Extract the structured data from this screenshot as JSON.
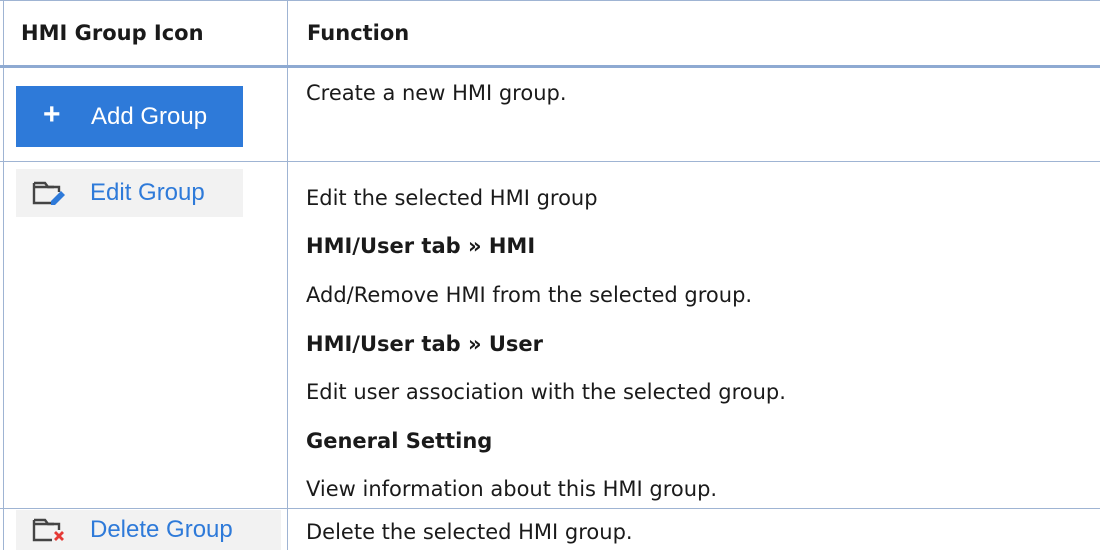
{
  "header": {
    "col1": "HMI Group Icon",
    "col2": "Function"
  },
  "rows": [
    {
      "button_label": "Add Group",
      "button_icon": "plus-icon",
      "lines": [
        {
          "text": "Create a new HMI group.",
          "bold": false
        }
      ]
    },
    {
      "button_label": "Edit Group",
      "button_icon": "folder-edit-icon",
      "lines": [
        {
          "text": "Edit the selected HMI group",
          "bold": false
        },
        {
          "text": "HMI/User tab » HMI",
          "bold": true
        },
        {
          "text": "Add/Remove HMI from the selected group.",
          "bold": false
        },
        {
          "text": "HMI/User tab » User",
          "bold": true
        },
        {
          "text": "Edit user association with the selected group.",
          "bold": false
        },
        {
          "text": "General Setting",
          "bold": true
        },
        {
          "text": "View information about this HMI group.",
          "bold": false
        }
      ]
    },
    {
      "button_label": "Delete Group",
      "button_icon": "folder-delete-icon",
      "lines": [
        {
          "text": "Delete the selected HMI group.",
          "bold": false
        }
      ]
    }
  ],
  "colors": {
    "accent": "#2e7ad9",
    "border": "#9fb4d3",
    "delete_mark": "#e53935"
  }
}
